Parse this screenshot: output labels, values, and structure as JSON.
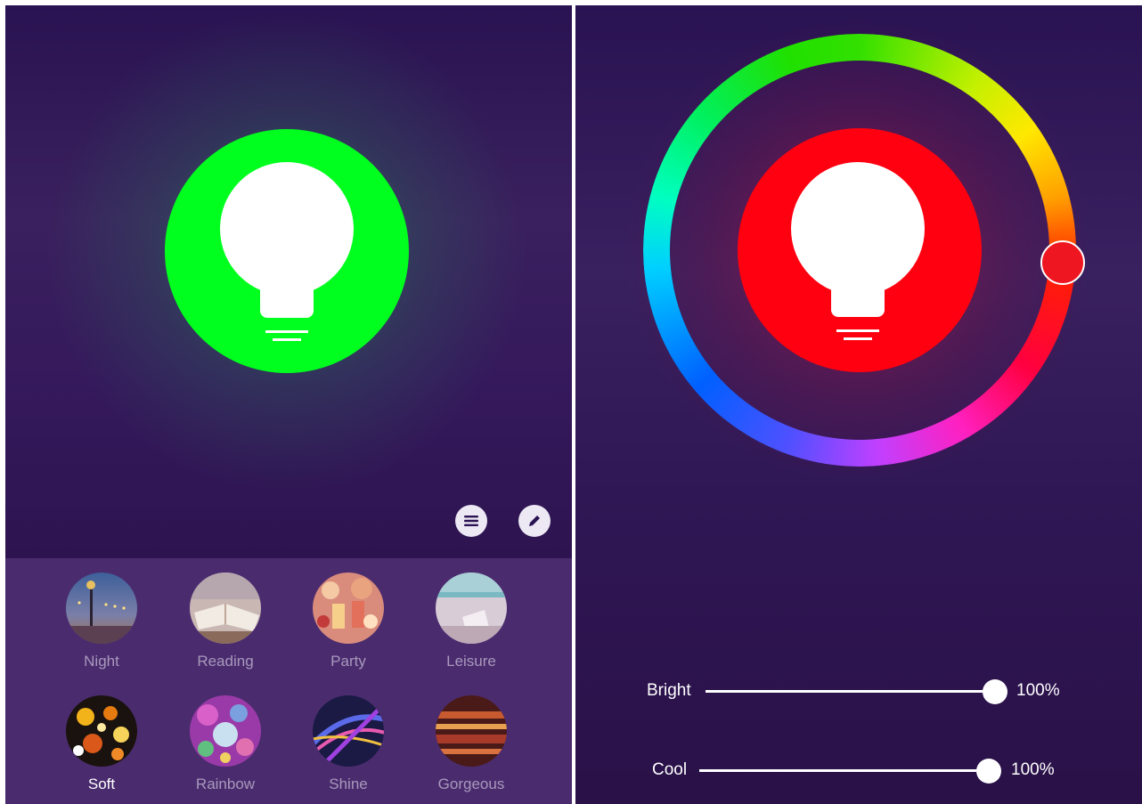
{
  "colors": {
    "left_bulb": "#00ff1e",
    "right_bulb": "#ff0010",
    "wheel_handle": "#ee1620"
  },
  "toolbar": {
    "list_icon": "list-icon",
    "edit_icon": "pencil-icon"
  },
  "scenes": [
    {
      "label": "Night",
      "active": false
    },
    {
      "label": "Reading",
      "active": false
    },
    {
      "label": "Party",
      "active": false
    },
    {
      "label": "Leisure",
      "active": false
    },
    {
      "label": "Soft",
      "active": true
    },
    {
      "label": "Rainbow",
      "active": false
    },
    {
      "label": "Shine",
      "active": false
    },
    {
      "label": "Gorgeous",
      "active": false
    }
  ],
  "sliders": {
    "bright": {
      "label": "Bright",
      "value_text": "100%",
      "value": 1.0
    },
    "cool": {
      "label": "Cool",
      "value_text": "100%",
      "value": 1.0
    }
  }
}
